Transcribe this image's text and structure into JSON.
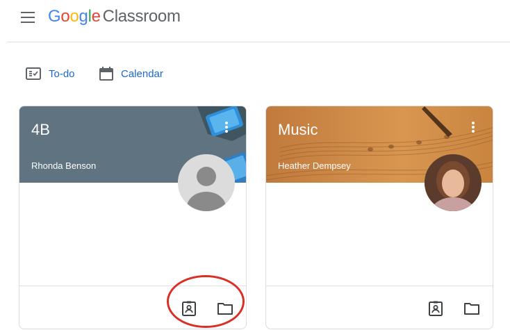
{
  "header": {
    "logo_letters": [
      "G",
      "o",
      "o",
      "g",
      "l",
      "e"
    ],
    "logo_product": "Classroom"
  },
  "nav": {
    "todo_label": "To-do",
    "calendar_label": "Calendar"
  },
  "classes": [
    {
      "title": "4B",
      "teacher": "Rhonda Benson",
      "banner_color": "#5f7380"
    },
    {
      "title": "Music",
      "teacher": "Heather Dempsey",
      "banner_color": "#c98540"
    }
  ],
  "colors": {
    "accent": "#1967d2",
    "highlight_circle": "#d93025"
  },
  "icons": [
    "menu-icon",
    "todo-icon",
    "calendar-icon",
    "more-vert-icon",
    "assignment-ind-icon",
    "folder-icon"
  ]
}
